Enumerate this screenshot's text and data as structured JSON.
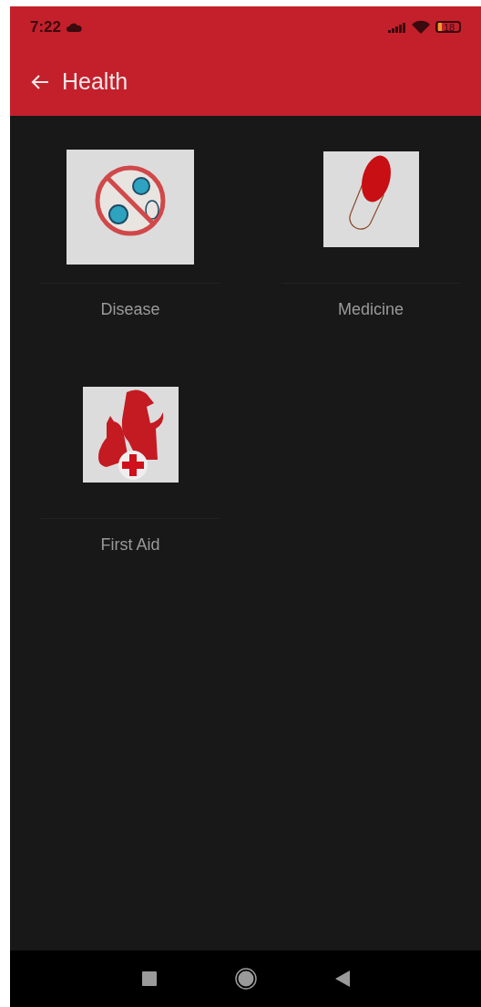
{
  "status_bar": {
    "time": "7:22",
    "battery": "18"
  },
  "app_bar": {
    "title": "Health"
  },
  "items": [
    {
      "label": "Disease",
      "kind": "virus"
    },
    {
      "label": "Medicine",
      "kind": "capsule"
    },
    {
      "label": "First Aid",
      "kind": "pets"
    }
  ]
}
